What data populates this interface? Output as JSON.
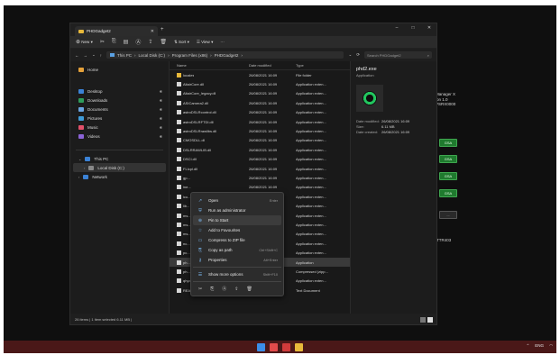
{
  "window": {
    "tab_title": "PHDGadget2",
    "controls": [
      "–",
      "□",
      "✕"
    ]
  },
  "commandbar": {
    "new_label": "New",
    "sort_label": "Sort",
    "view_label": "View",
    "more_label": "···"
  },
  "addressbar": {
    "path": [
      "This PC",
      "Local Disk (C:)",
      "Program Files (x86)",
      "PHDGadget2"
    ],
    "search_placeholder": "Search PHDGadget2"
  },
  "nav": {
    "items": [
      {
        "label": "Home",
        "color": "#e5a13a",
        "pinned": false
      },
      {
        "label": "Desktop",
        "color": "#3b82d6",
        "pinned": true
      },
      {
        "label": "Downloads",
        "color": "#2e9c5a",
        "pinned": true
      },
      {
        "label": "Documents",
        "color": "#6aa4e0",
        "pinned": true
      },
      {
        "label": "Pictures",
        "color": "#3f9bd8",
        "pinned": true
      },
      {
        "label": "Music",
        "color": "#e2506a",
        "pinned": true
      },
      {
        "label": "Videos",
        "color": "#8b63d6",
        "pinned": true
      }
    ],
    "tree": [
      {
        "label": "This PC",
        "color": "#3b82d6"
      },
      {
        "label": "Local Disk (C:)",
        "color": "#888888"
      },
      {
        "label": "Network",
        "color": "#3b82d6"
      }
    ]
  },
  "files": {
    "headers": {
      "name": "Name",
      "date": "Date modified",
      "type": "Type"
    },
    "rows": [
      {
        "name": "locales",
        "date": "26/08/2021 16:09",
        "type": "File folder",
        "dir": true
      },
      {
        "name": "AltairCore.dll",
        "date": "26/08/2021 16:09",
        "type": "Application exten...",
        "dir": false
      },
      {
        "name": "AltairCore_legacy.dll",
        "date": "26/08/2021 16:09",
        "type": "Application exten...",
        "dir": false
      },
      {
        "name": "ASICamera2.dll",
        "date": "26/08/2021 16:09",
        "type": "Application exten...",
        "dir": false
      },
      {
        "name": "astroDSLRcontrol.dll",
        "date": "26/08/2021 16:09",
        "type": "Application exten...",
        "dir": false
      },
      {
        "name": "astroDSLRFTDI.dll",
        "date": "26/08/2021 16:09",
        "type": "Application exten...",
        "dir": false
      },
      {
        "name": "astroDSLRrawlibs.dll",
        "date": "26/08/2021 16:09",
        "type": "Application exten...",
        "dir": false
      },
      {
        "name": "CMOSDLL.dll",
        "date": "26/08/2021 16:09",
        "type": "Application exten...",
        "dir": false
      },
      {
        "name": "DSLRRAWLIB.dll",
        "date": "26/08/2021 16:09",
        "type": "Application exten...",
        "dir": false
      },
      {
        "name": "DSCI.dll",
        "date": "26/08/2021 16:09",
        "type": "Application exten...",
        "dir": false
      },
      {
        "name": "FLIcpl.dll",
        "date": "26/08/2021 16:09",
        "type": "Application exten...",
        "dir": false
      },
      {
        "name": "gp...",
        "date": "26/08/2021 16:09",
        "type": "Application exten...",
        "dir": false
      },
      {
        "name": "ine...",
        "date": "26/08/2021 16:09",
        "type": "Application exten...",
        "dir": false
      },
      {
        "name": "icu...",
        "date": "26/08/2021 16:09",
        "type": "Application exten...",
        "dir": false
      },
      {
        "name": "lib...",
        "date": "26/08/2021 16:09",
        "type": "Application exten...",
        "dir": false
      },
      {
        "name": "ms...",
        "date": "26/08/2021 16:11",
        "type": "Application exten...",
        "dir": false
      },
      {
        "name": "ms...",
        "date": "26/08/2021 16:09",
        "type": "Application exten...",
        "dir": false
      },
      {
        "name": "ms...",
        "date": "26/08/2021 16:09",
        "type": "Application exten...",
        "dir": false
      },
      {
        "name": "nc...",
        "date": "26/08/2021 16:09",
        "type": "Application exten...",
        "dir": false
      },
      {
        "name": "pc...",
        "date": "26/08/2021 16:09",
        "type": "Application exten...",
        "dir": false
      },
      {
        "name": "ph...",
        "date": "26/08/2021 16:09",
        "type": "Application",
        "dir": false,
        "sel": true
      },
      {
        "name": "ph...",
        "date": "26/08/2021 16:09",
        "type": "Compressed (zipp...",
        "dir": false
      },
      {
        "name": "qhyccd.dll",
        "date": "26/08/2021 16:09",
        "type": "Application exten...",
        "dir": false
      },
      {
        "name": "README-PHD2.txt",
        "date": "26/08/2021 16:09",
        "type": "Text Document",
        "dir": false
      }
    ]
  },
  "details": {
    "title": "phd2.exe",
    "subtitle": "Application",
    "props": [
      {
        "k": "Date modified:",
        "v": "26/08/2021 16:09"
      },
      {
        "k": "Size:",
        "v": "6.11 MB"
      },
      {
        "k": "Date created:",
        "v": "26/08/2021 16:09"
      }
    ]
  },
  "status": {
    "text": "26 items  |  1 item selected  6.11 MB  |"
  },
  "context_menu": {
    "items": [
      {
        "label": "Open",
        "shortcut": "Enter",
        "icon": "↗"
      },
      {
        "label": "Run as administrator",
        "shortcut": "",
        "icon": "⛨"
      },
      {
        "label": "Pin to Start",
        "shortcut": "",
        "icon": "⊕",
        "hover": true
      },
      {
        "label": "Add to Favourites",
        "shortcut": "",
        "icon": "☆"
      },
      {
        "label": "Compress to ZIP file",
        "shortcut": "",
        "icon": "▭"
      },
      {
        "label": "Copy as path",
        "shortcut": "Ctrl+Shift+C",
        "icon": "⎘"
      },
      {
        "label": "Properties",
        "shortcut": "Alt+Enter",
        "icon": "⚷"
      },
      {
        "label": "Show more options",
        "shortcut": "Shift+F10",
        "icon": "☰"
      }
    ]
  },
  "background_app": {
    "text_lines": [
      "Manager X",
      "ion 1.0",
      "PSRX0000"
    ],
    "buttons": [
      "GSA",
      "GSA",
      "GSA",
      "GSA",
      "..."
    ],
    "label": "TTR403"
  },
  "tray": {
    "lang": "ENG"
  }
}
